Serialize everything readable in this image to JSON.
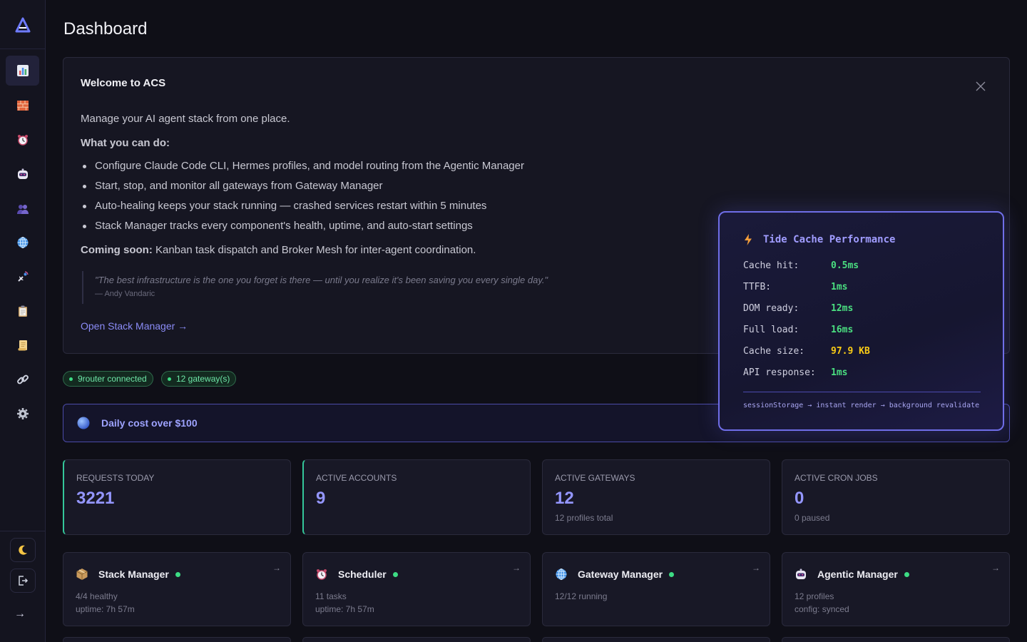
{
  "page": {
    "title": "Dashboard"
  },
  "sidebar": {
    "logo": "logo-icon",
    "items": [
      {
        "icon": "bar-chart-icon",
        "active": true
      },
      {
        "icon": "brick-wall-icon"
      },
      {
        "icon": "alarm-clock-icon"
      },
      {
        "icon": "robot-icon"
      },
      {
        "icon": "users-icon"
      },
      {
        "icon": "globe-icon"
      },
      {
        "icon": "satellite-icon"
      },
      {
        "icon": "clipboard-icon"
      },
      {
        "icon": "scroll-icon"
      },
      {
        "icon": "link-icon"
      },
      {
        "icon": "gear-icon"
      }
    ],
    "theme_toggle": "moon-icon",
    "logout": "logout-icon",
    "expand": "→"
  },
  "welcome": {
    "title": "Welcome to ACS",
    "intro": "Manage your AI agent stack from one place.",
    "subhead": "What you can do:",
    "bullets": [
      "Configure Claude Code CLI, Hermes profiles, and model routing from the Agentic Manager",
      "Start, stop, and monitor all gateways from Gateway Manager",
      "Auto-healing keeps your stack running — crashed services restart within 5 minutes",
      "Stack Manager tracks every component's health, uptime, and auto-start settings"
    ],
    "soon_label": "Coming soon:",
    "soon_text": " Kanban task dispatch and Broker Mesh for inter-agent coordination.",
    "quote": "\"The best infrastructure is the one you forget is there — until you realize it's been saving you every single day.\"",
    "quote_author": "— Andy Vandaric",
    "link": "Open Stack Manager →"
  },
  "status": [
    {
      "label": "9router connected"
    },
    {
      "label": "12 gateway(s)"
    }
  ],
  "alert": {
    "text": "Daily cost over $100"
  },
  "stats": [
    {
      "label": "REQUESTS TODAY",
      "value": "3221",
      "sub": ""
    },
    {
      "label": "ACTIVE ACCOUNTS",
      "value": "9",
      "sub": ""
    },
    {
      "label": "ACTIVE GATEWAYS",
      "value": "12",
      "sub": "12 profiles total"
    },
    {
      "label": "ACTIVE CRON JOBS",
      "value": "0",
      "sub": "0 paused"
    }
  ],
  "services": [
    {
      "name": "Stack Manager",
      "icon": "package-icon",
      "line1": "4/4 healthy",
      "line2": "uptime: 7h 57m",
      "arrow": "→"
    },
    {
      "name": "Scheduler",
      "icon": "alarm-clock-icon",
      "line1": "11 tasks",
      "line2": "uptime: 7h 57m",
      "arrow": "→"
    },
    {
      "name": "Gateway Manager",
      "icon": "globe-icon",
      "line1": "12/12 running",
      "line2": "",
      "arrow": "→"
    },
    {
      "name": "Agentic Manager",
      "icon": "robot-icon",
      "line1": "12 profiles",
      "line2": "config: synced",
      "arrow": "→"
    }
  ],
  "perf": {
    "title": "Tide Cache Performance",
    "rows": [
      {
        "key": "Cache hit:",
        "value": "0.5ms"
      },
      {
        "key": "TTFB:",
        "value": "1ms"
      },
      {
        "key": "DOM ready:",
        "value": "12ms"
      },
      {
        "key": "Full load:",
        "value": "16ms"
      },
      {
        "key": "Cache size:",
        "value": "97.9 KB"
      },
      {
        "key": "API response:",
        "value": "1ms"
      }
    ],
    "footer": "sessionStorage → instant render → background revalidate"
  },
  "colors": {
    "accent": "#9496ff",
    "success": "#3ddc84",
    "warning": "#facc15",
    "background": "#0f0f17"
  }
}
